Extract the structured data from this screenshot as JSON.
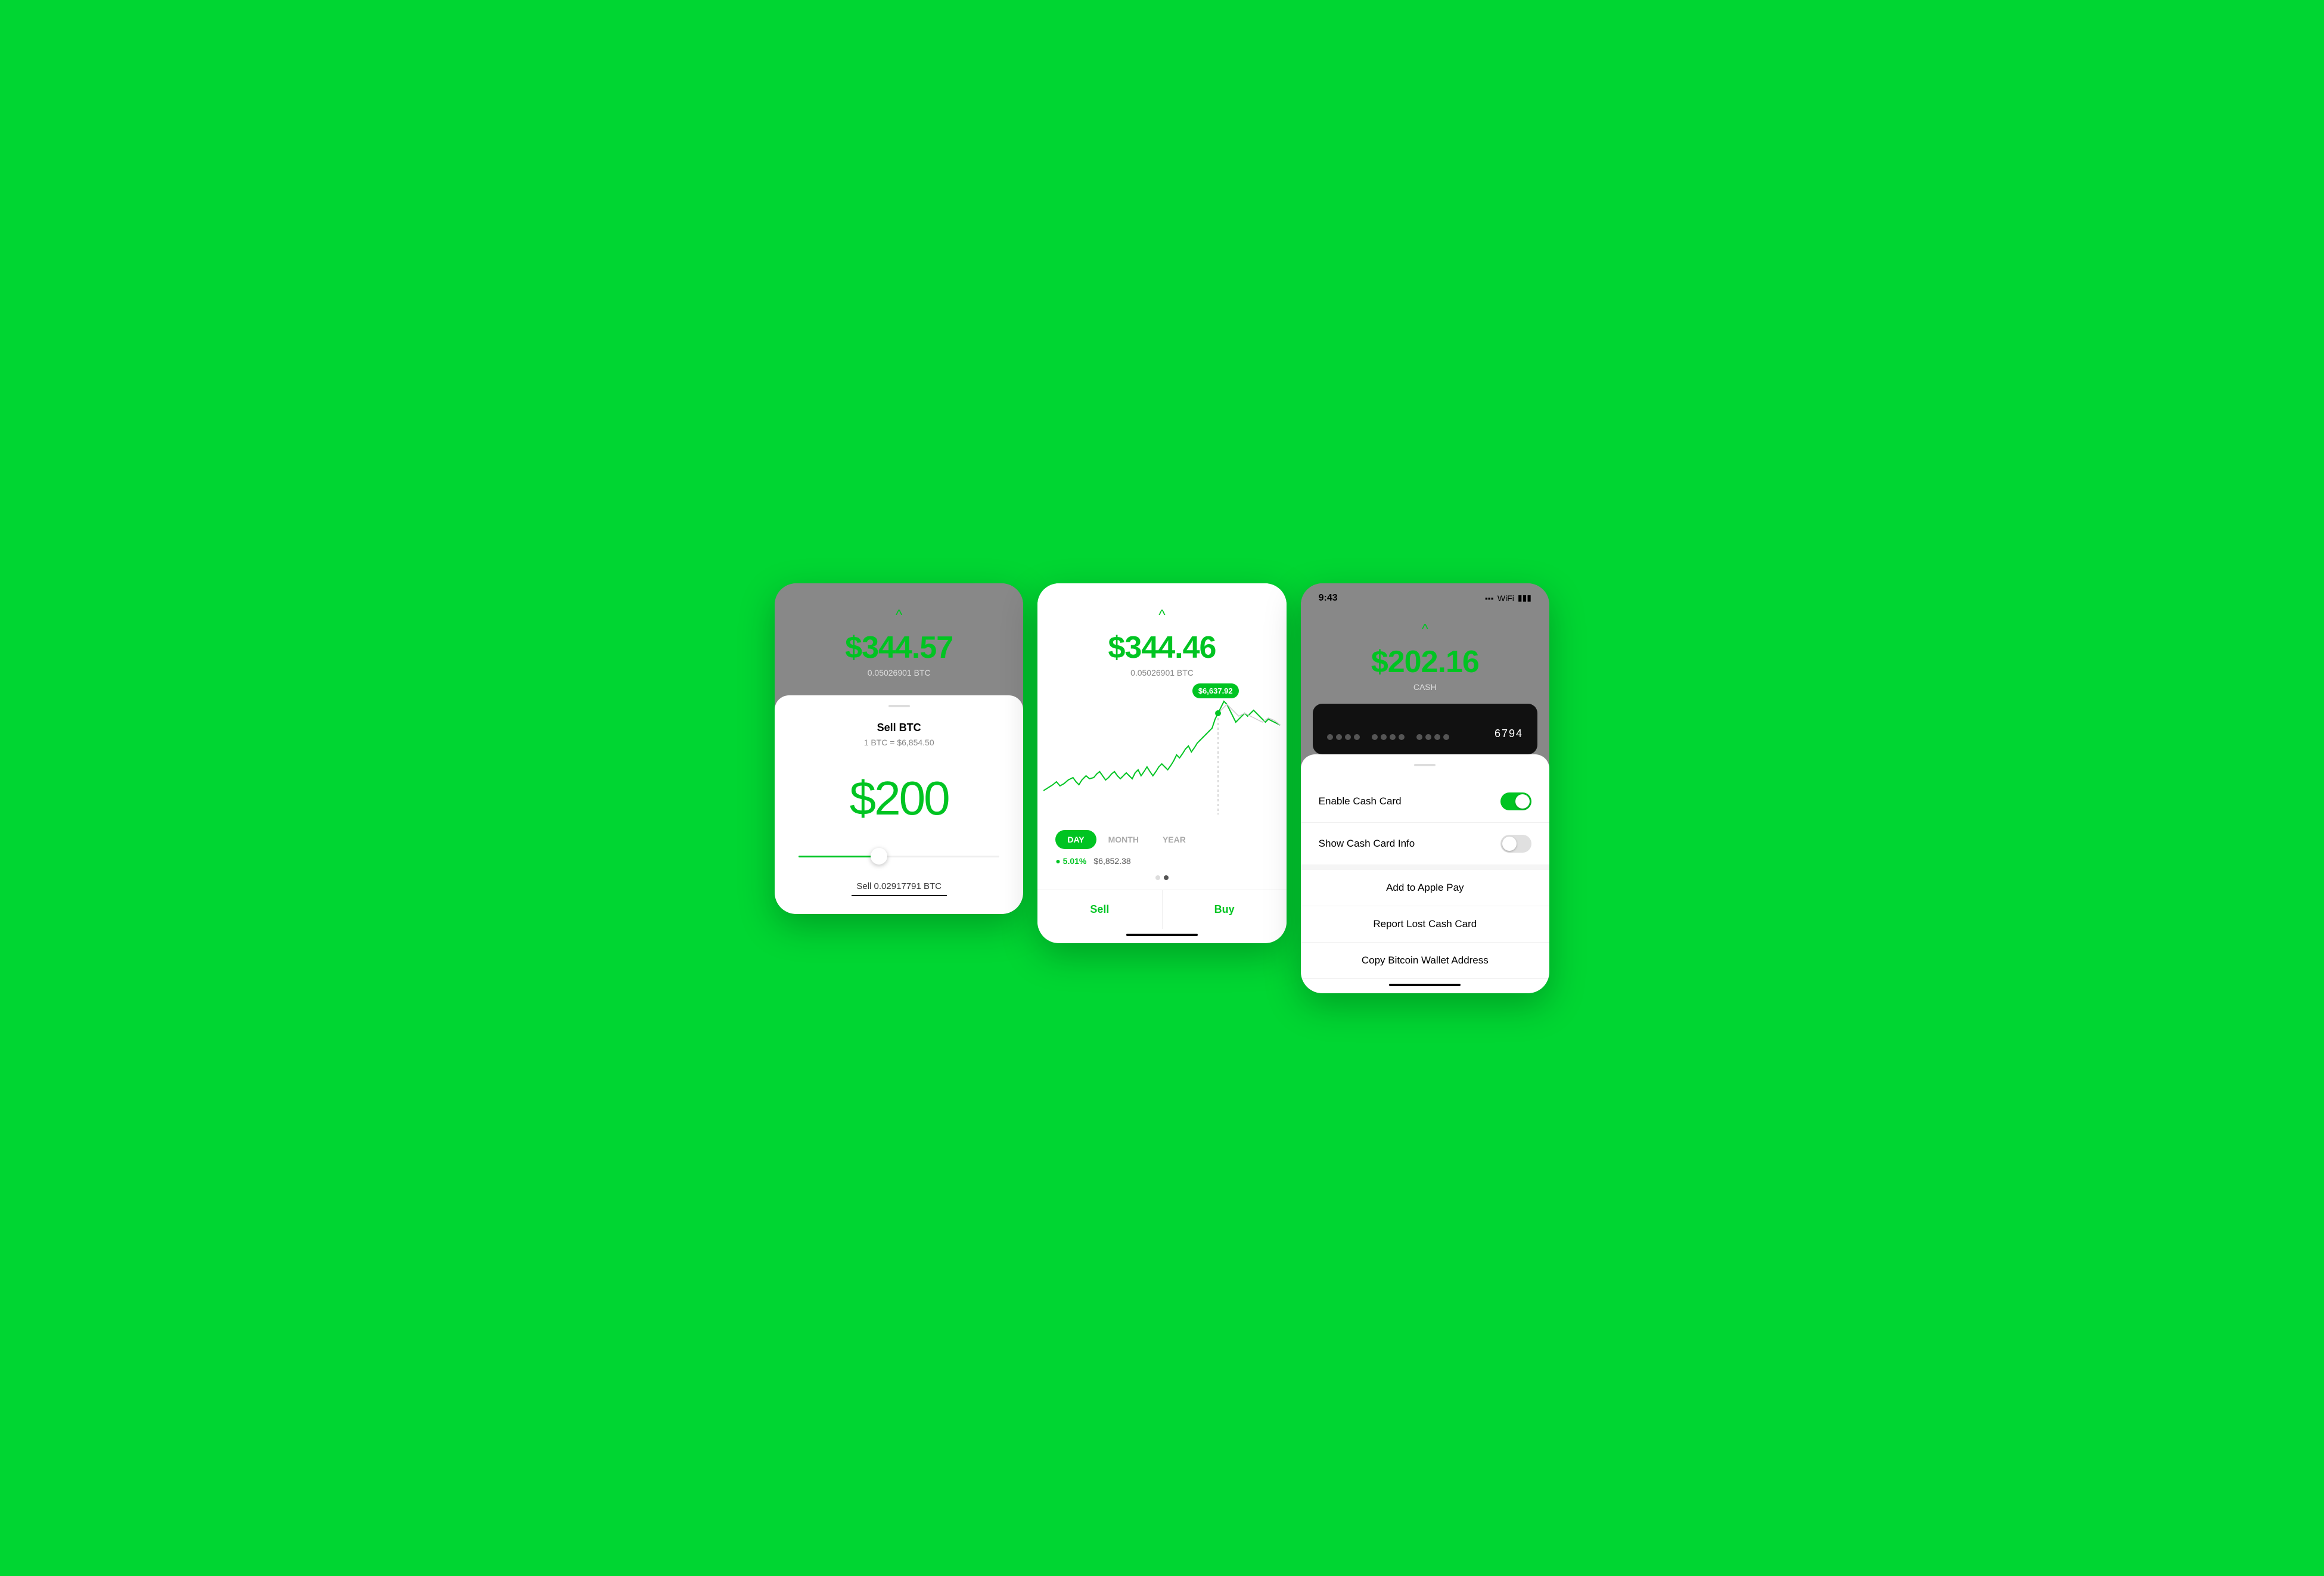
{
  "screen1": {
    "chevron": "^",
    "btc_value": "$344.57",
    "btc_amount": "0.05026901 BTC",
    "handle_label": "drag-handle",
    "sell_title": "Sell BTC",
    "sell_rate": "1 BTC = $6,854.50",
    "amount_dollar": "$",
    "amount_value": "200",
    "sell_label": "Sell 0.02917791 BTC",
    "slider_pct": 40
  },
  "screen2": {
    "chevron": "^",
    "btc_value": "$344.46",
    "btc_amount": "0.05026901 BTC",
    "tooltip_price": "$6,637.92",
    "time_tabs": [
      "DAY",
      "MONTH",
      "YEAR"
    ],
    "active_tab": "DAY",
    "stat_pct": "● 5.01%",
    "stat_price": "$6,852.38",
    "sell_btn": "Sell",
    "buy_btn": "Buy"
  },
  "screen3": {
    "status_time": "9:43",
    "chevron": "^",
    "cash_value": "$202.16",
    "cash_label": "CASH",
    "card_dots1": "● ● ● ●",
    "card_dots2": "● ● ● ●",
    "card_dots3": "● ● ● ●",
    "card_number": "6794",
    "menu_items": [
      {
        "label": "Enable Cash Card",
        "type": "toggle",
        "state": "on"
      },
      {
        "label": "Show Cash Card Info",
        "type": "toggle",
        "state": "off"
      },
      {
        "label": "Add to Apple Pay",
        "type": "text"
      },
      {
        "label": "Report Lost Cash Card",
        "type": "text"
      },
      {
        "label": "Copy Bitcoin Wallet Address",
        "type": "text"
      }
    ]
  },
  "colors": {
    "green": "#00C422",
    "bg_green": "#00D632",
    "gray": "#888888",
    "white": "#ffffff"
  }
}
